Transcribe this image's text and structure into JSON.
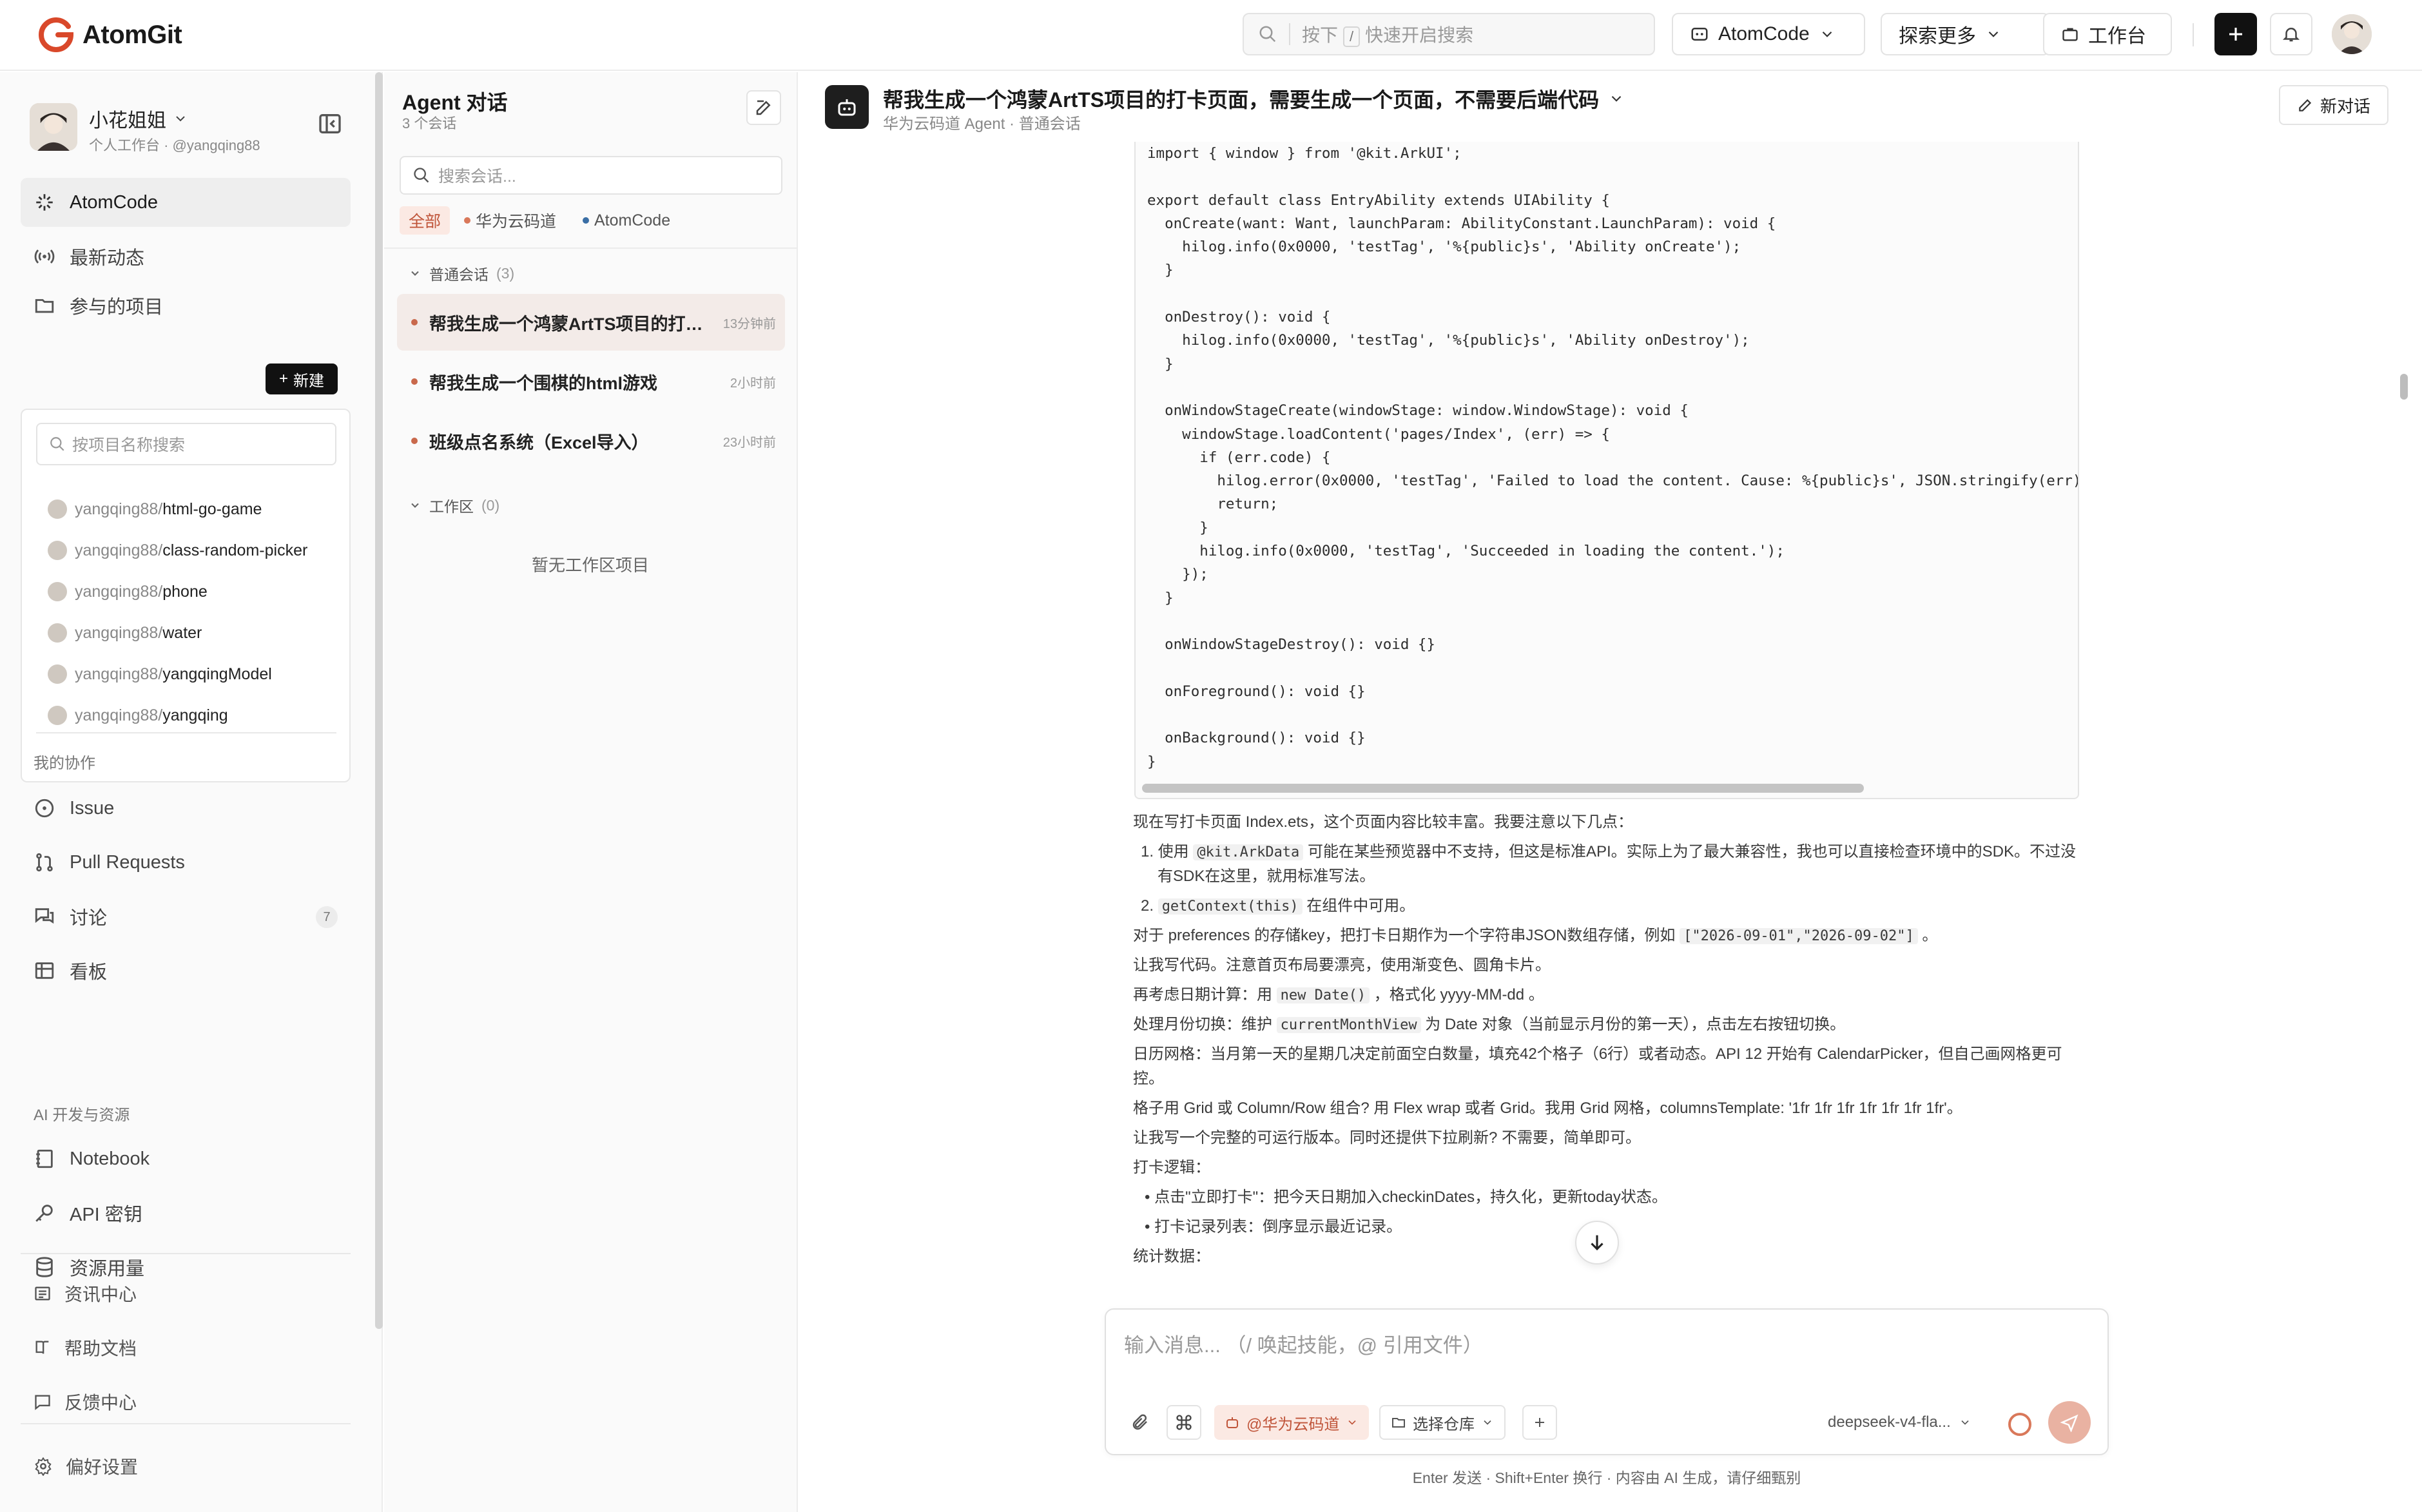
{
  "brand": {
    "name": "AtomGit",
    "accent": "#d9482a"
  },
  "topbar": {
    "search_prefix": "按下",
    "search_key": "/",
    "search_suffix": "快速开启搜索",
    "atomcode_label": "AtomCode",
    "explore_label": "探索更多",
    "workbench_label": "工作台"
  },
  "user": {
    "name": "小花姐姐",
    "sub": "个人工作台 · @yangqing88"
  },
  "sidebar": {
    "atomcode": "AtomCode",
    "news": "最新动态",
    "projects": "参与的项目",
    "new_label": "新建",
    "project_search_placeholder": "按项目名称搜索",
    "projects_list": [
      {
        "owner": "yangqing88/",
        "name": "html-go-game"
      },
      {
        "owner": "yangqing88/",
        "name": "class-random-picker"
      },
      {
        "owner": "yangqing88/",
        "name": "phone"
      },
      {
        "owner": "yangqing88/",
        "name": "water"
      },
      {
        "owner": "yangqing88/",
        "name": "yangqingModel"
      },
      {
        "owner": "yangqing88/",
        "name": "yangqing"
      }
    ],
    "collab_label": "我的协作",
    "issue": "Issue",
    "pulls": "Pull Requests",
    "discuss": "讨论",
    "discuss_count": "7",
    "board": "看板",
    "ai_label": "AI 开发与资源",
    "notebook": "Notebook",
    "apikey": "API 密钥",
    "usage": "资源用量",
    "info_center": "资讯中心",
    "help_docs": "帮助文档",
    "feedback": "反馈中心",
    "prefs": "偏好设置"
  },
  "convlist": {
    "title": "Agent 对话",
    "sub": "3 个会话",
    "search_placeholder": "搜索会话...",
    "filters": {
      "all": "全部",
      "huawei": "华为云码道",
      "atomcode": "AtomCode"
    },
    "group_normal": "普通会话",
    "group_normal_count": "(3)",
    "items": [
      {
        "title": "帮我生成一个鸿蒙ArtTS项目的打卡页面，需要生成一个页面，不需要后端代码",
        "time": "13分钟前"
      },
      {
        "title": "帮我生成一个围棋的html游戏",
        "time": "2小时前"
      },
      {
        "title": "班级点名系统（Excel导入）",
        "time": "23小时前"
      }
    ],
    "group_ws": "工作区",
    "group_ws_count": "(0)",
    "empty_ws": "暂无工作区项目"
  },
  "chat": {
    "title": "帮我生成一个鸿蒙ArtTS项目的打卡页面，需要生成一个页面，不需要后端代码",
    "sub": "华为云码道 Agent · 普通会话",
    "new_chat": "新对话",
    "code_lines": [
      "import { window } from '@kit.ArkUI';",
      "",
      "export default class EntryAbility extends UIAbility {",
      "  onCreate(want: Want, launchParam: AbilityConstant.LaunchParam): void {",
      "    hilog.info(0x0000, 'testTag', '%{public}s', 'Ability onCreate');",
      "  }",
      "",
      "  onDestroy(): void {",
      "    hilog.info(0x0000, 'testTag', '%{public}s', 'Ability onDestroy');",
      "  }",
      "",
      "  onWindowStageCreate(windowStage: window.WindowStage): void {",
      "    windowStage.loadContent('pages/Index', (err) => {",
      "      if (err.code) {",
      "        hilog.error(0x0000, 'testTag', 'Failed to load the content. Cause: %{public}s', JSON.stringify(err) ?",
      "        return;",
      "      }",
      "      hilog.info(0x0000, 'testTag', 'Succeeded in loading the content.');",
      "    });",
      "  }",
      "",
      "  onWindowStageDestroy(): void {}",
      "",
      "  onForeground(): void {}",
      "",
      "  onBackground(): void {}",
      "}"
    ],
    "explain": {
      "p1": "现在写打卡页面 Index.ets，这个页面内容比较丰富。我要注意以下几点：",
      "l1_num": "1.",
      "l1_a": "使用",
      "l1_code": "@kit.ArkData",
      "l1_b": "可能在某些预览器中不支持，但这是标准API。实际上为了最大兼容性，我也可以直接检查环境中的SDK。不过没",
      "l1_c": "有SDK在这里，就用标准写法。",
      "l2_num": "2.",
      "l2_code": "getContext(this)",
      "l2_b": "在组件中可用。",
      "p2_a": "对于 preferences 的存储key，把打卡日期作为一个字符串JSON数组存储，例如",
      "p2_code": "[\"2026-09-01\",\"2026-09-02\"]",
      "p2_b": "。",
      "p3": "让我写代码。注意首页布局要漂亮，使用渐变色、圆角卡片。",
      "p4_a": "再考虑日期计算：用",
      "p4_code": "new Date()",
      "p4_b": "，格式化 yyyy-MM-dd 。",
      "p5_a": "处理月份切换：维护",
      "p5_code": "currentMonthView",
      "p5_b": "为 Date 对象（当前显示月份的第一天），点击左右按钮切换。",
      "p6a": "日历网格：当月第一天的星期几决定前面空白数量，填充42个格子（6行）或者动态。API 12 开始有 CalendarPicker，但自己画网格更可",
      "p6b": "控。",
      "p7": "格子用 Grid 或 Column/Row 组合? 用 Flex wrap 或者 Grid。我用 Grid 网格，columnsTemplate: '1fr 1fr 1fr 1fr 1fr 1fr 1fr'。",
      "p8": "让我写一个完整的可运行版本。同时还提供下拉刷新? 不需要，简单即可。",
      "p9": "打卡逻辑：",
      "b1": "点击\"立即打卡\"：把今天日期加入checkinDates，持久化，更新today状态。",
      "b2": "打卡记录列表：倒序显示最近记录。",
      "p10": "统计数据："
    }
  },
  "composer": {
    "placeholder": "输入消息...  （/ 唤起技能，@ 引用文件）",
    "agent_tag": "@华为云码道",
    "repo_label": "选择仓库",
    "model": "deepseek-v4-fla...",
    "footer": "Enter 发送 · Shift+Enter 换行 · 内容由 AI 生成，请仔细甄别"
  }
}
